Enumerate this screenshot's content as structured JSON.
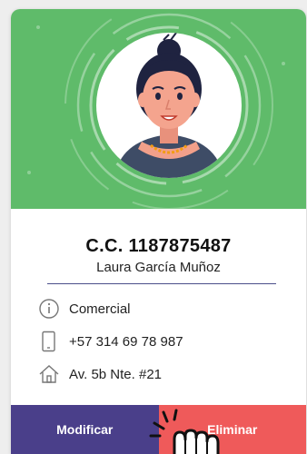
{
  "person": {
    "document_id": "C.C. 1187875487",
    "full_name": "Laura García Muñoz"
  },
  "details": {
    "role": "Comercial",
    "phone": "+57 314 69 78 987",
    "address": "Av. 5b Nte. #21"
  },
  "icons": {
    "role": "info-icon",
    "phone": "phone-icon",
    "address": "home-icon",
    "cursor": "hand-pointer-icon"
  },
  "actions": {
    "edit_label": "Modificar",
    "delete_label": "Eliminar"
  },
  "colors": {
    "banner": "#5fbb6a",
    "edit_button": "#4a3f8a",
    "delete_button": "#ef5a5a",
    "divider": "#4a4e8a"
  }
}
